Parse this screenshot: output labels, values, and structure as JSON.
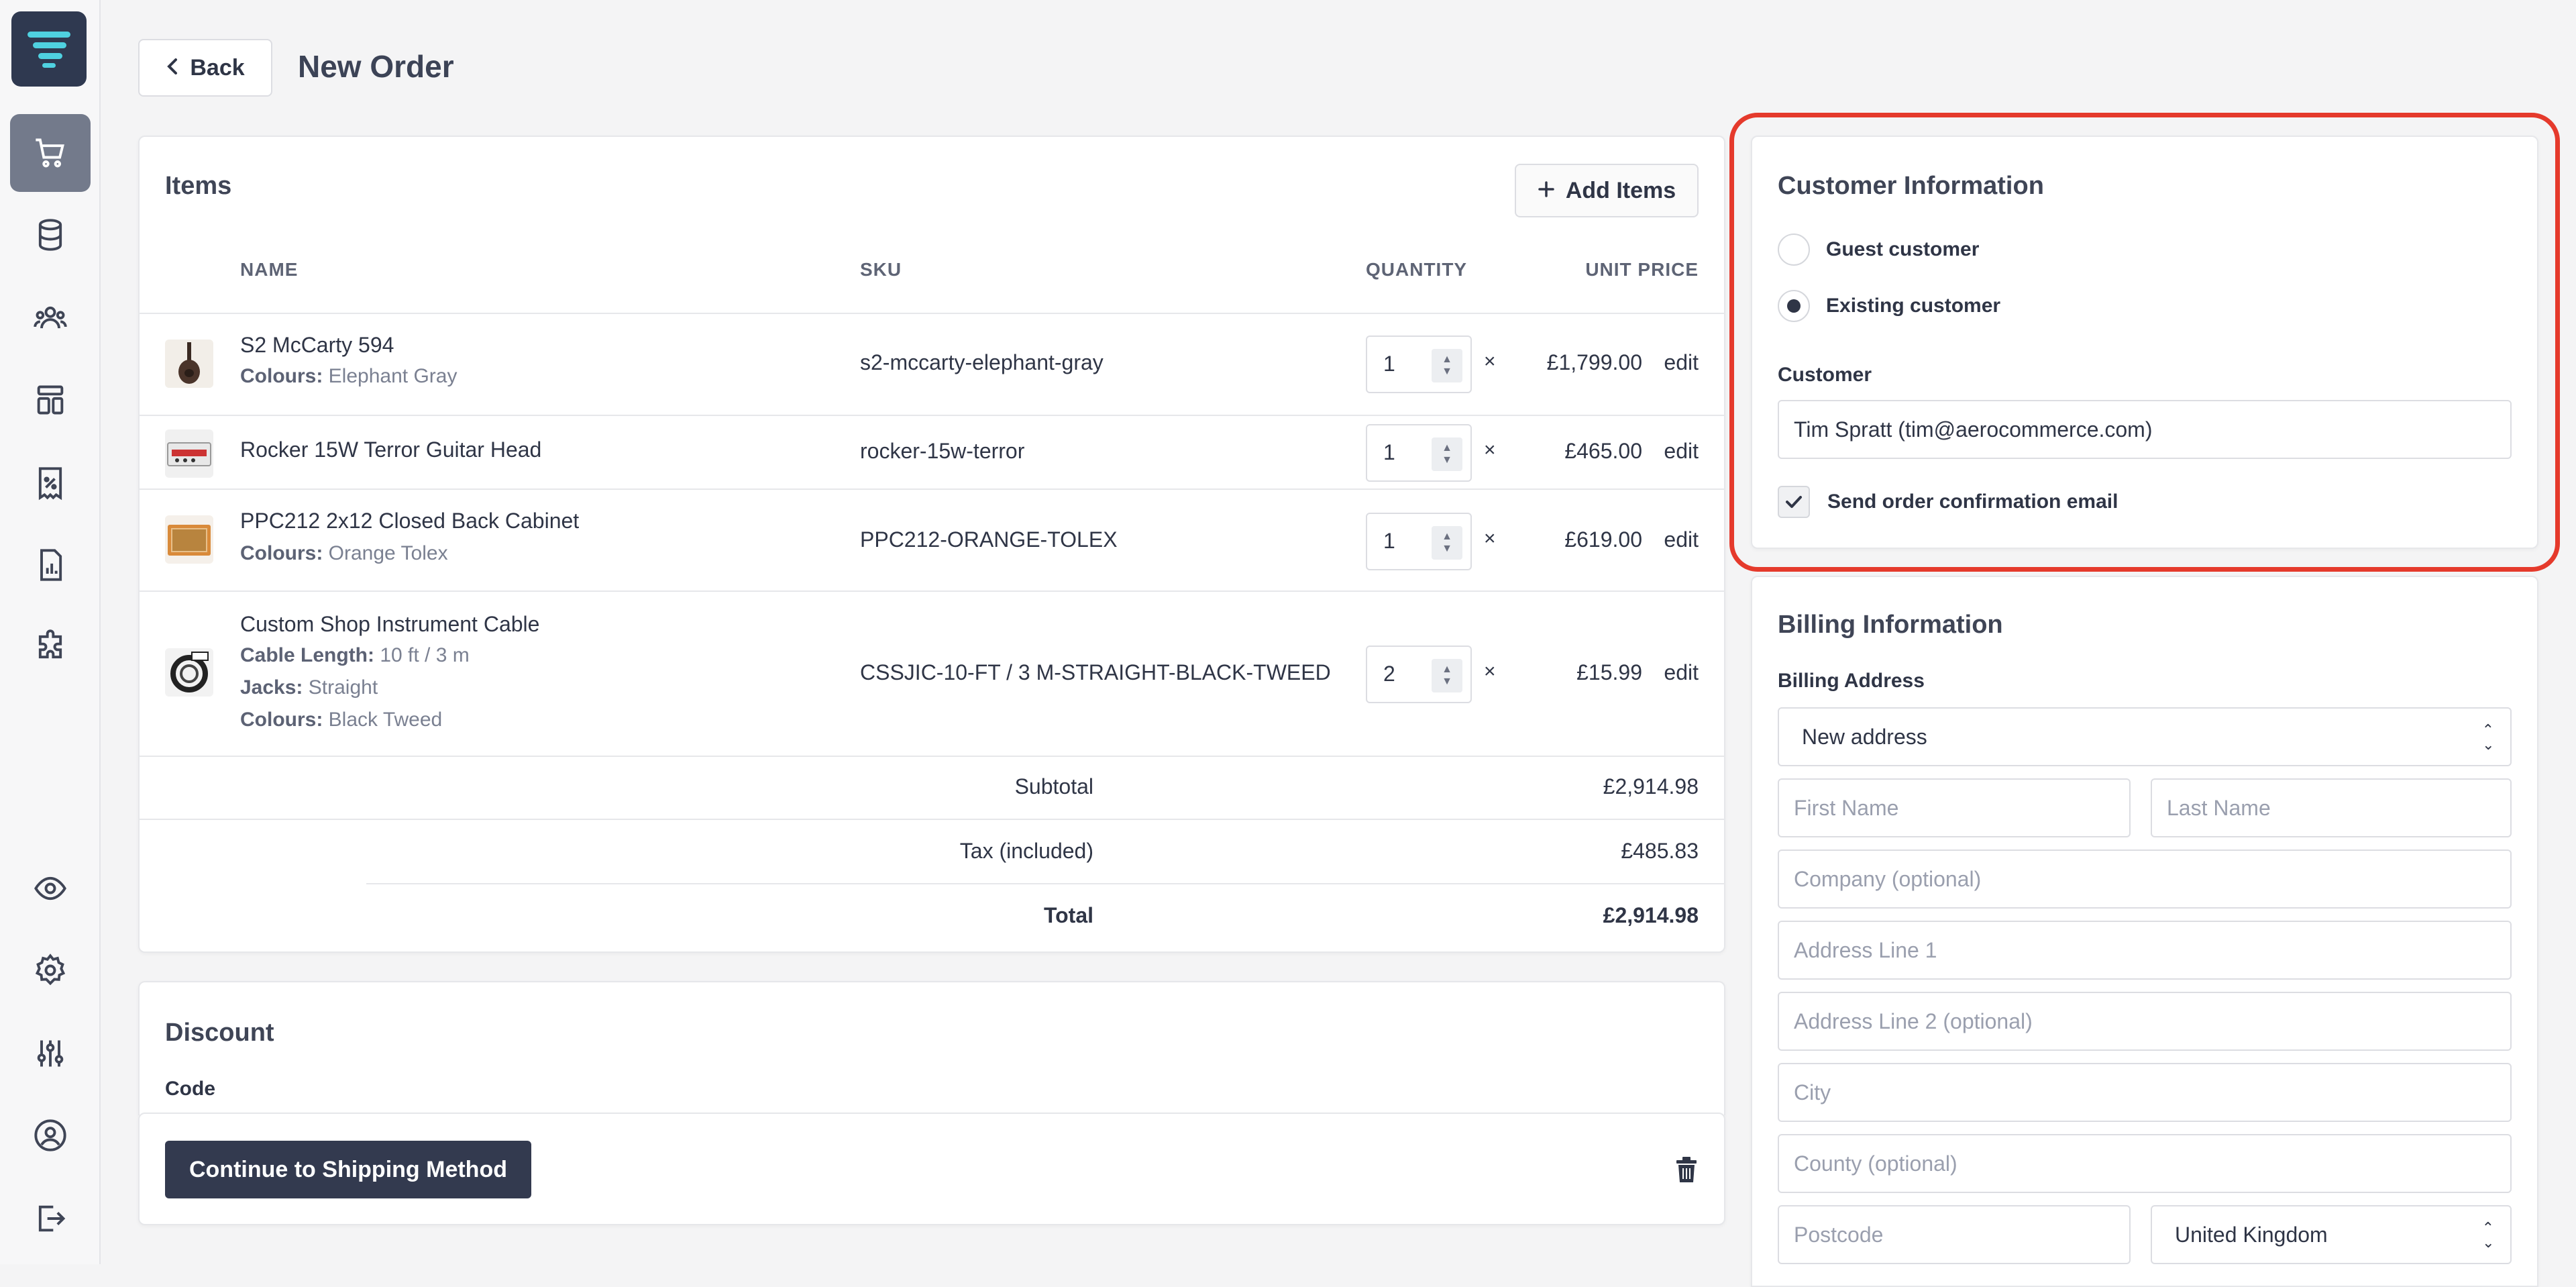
{
  "header": {
    "back_label": "Back",
    "title": "New Order"
  },
  "items": {
    "title": "Items",
    "add_label": "Add Items",
    "columns": {
      "name": "NAME",
      "sku": "SKU",
      "quantity": "QUANTITY",
      "unit_price": "UNIT PRICE"
    },
    "rows": [
      {
        "name": "S2 McCarty 594",
        "attrs": [
          {
            "k": "Colours:",
            "v": "Elephant Gray"
          }
        ],
        "sku": "s2-mccarty-elephant-gray",
        "qty": "1",
        "price": "£1,799.00",
        "edit": "edit"
      },
      {
        "name": "Rocker 15W Terror Guitar Head",
        "attrs": [],
        "sku": "rocker-15w-terror",
        "qty": "1",
        "price": "£465.00",
        "edit": "edit"
      },
      {
        "name": "PPC212 2x12 Closed Back Cabinet",
        "attrs": [
          {
            "k": "Colours:",
            "v": "Orange Tolex"
          }
        ],
        "sku": "PPC212-ORANGE-TOLEX",
        "qty": "1",
        "price": "£619.00",
        "edit": "edit"
      },
      {
        "name": "Custom Shop Instrument Cable",
        "attrs": [
          {
            "k": "Cable Length:",
            "v": "10 ft / 3 m"
          },
          {
            "k": "Jacks:",
            "v": "Straight"
          },
          {
            "k": "Colours:",
            "v": "Black Tweed"
          }
        ],
        "sku": "CSSJIC-10-FT / 3 M-STRAIGHT-BLACK-TWEED",
        "qty": "2",
        "price": "£15.99",
        "edit": "edit"
      }
    ],
    "times": "×",
    "subtotal_label": "Subtotal",
    "subtotal": "£2,914.98",
    "tax_label": "Tax (included)",
    "tax": "£485.83",
    "total_label": "Total",
    "total": "£2,914.98"
  },
  "discount": {
    "title": "Discount",
    "code_label": "Code"
  },
  "footer": {
    "continue_label": "Continue to Shipping Method"
  },
  "customer": {
    "title": "Customer Information",
    "guest_label": "Guest customer",
    "existing_label": "Existing customer",
    "selected": "existing",
    "field_label": "Customer",
    "value": "Tim Spratt (tim@aerocommerce.com)",
    "send_email_label": "Send order confirmation email",
    "send_email_checked": true
  },
  "billing": {
    "title": "Billing Information",
    "address_label": "Billing Address",
    "address_select": "New address",
    "first_name": "First Name",
    "last_name": "Last Name",
    "company": "Company (optional)",
    "line1": "Address Line 1",
    "line2": "Address Line 2 (optional)",
    "city": "City",
    "county": "County (optional)",
    "postcode": "Postcode",
    "country": "United Kingdom"
  },
  "colors": {
    "accent": "#333a4f",
    "highlight": "#e53a2c",
    "logo_bg": "#2f3950",
    "logo_fg": "#4fd1e0"
  },
  "sidebar_icons": [
    "cart-icon",
    "database-icon",
    "users-icon",
    "layout-icon",
    "discount-icon",
    "report-icon",
    "puzzle-icon",
    "eye-icon",
    "gear-icon",
    "sliders-icon",
    "user-circle-icon",
    "logout-icon"
  ]
}
